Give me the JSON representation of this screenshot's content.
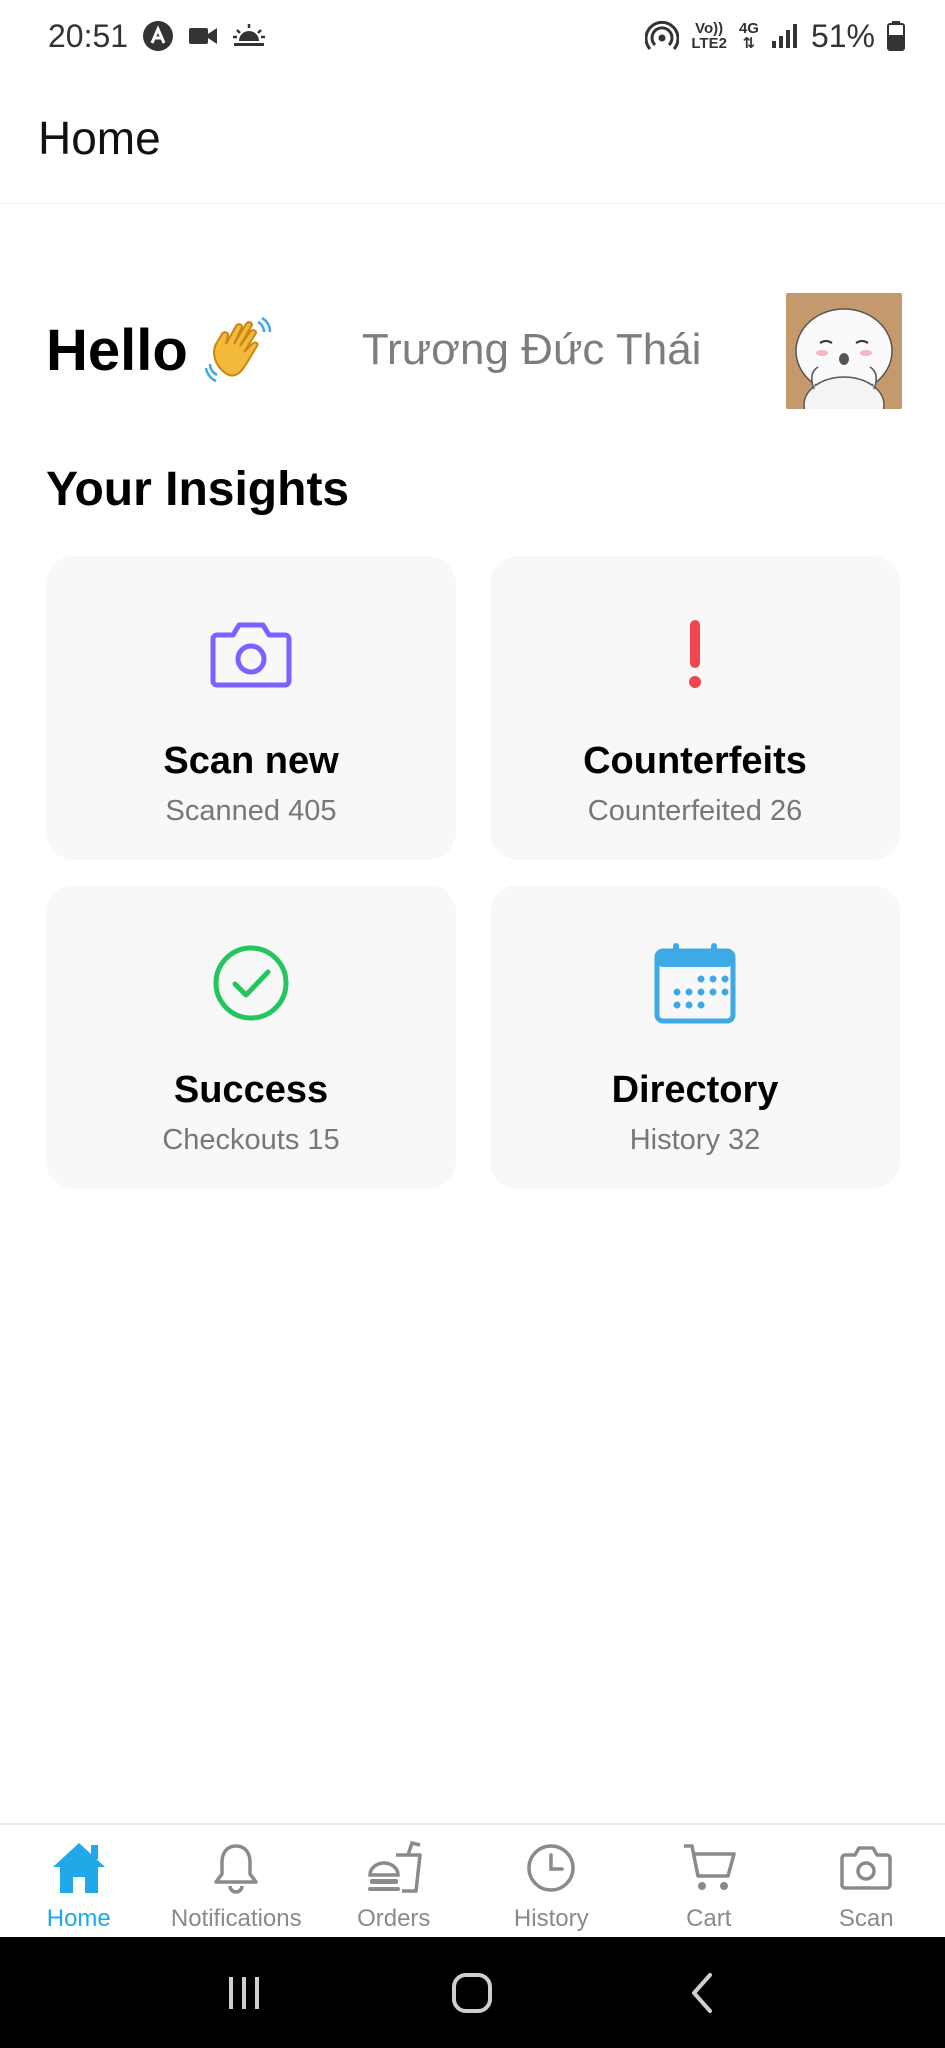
{
  "status_bar": {
    "time": "20:51",
    "volte": "Vo))",
    "lte": "LTE2",
    "network": "4G",
    "battery": "51%"
  },
  "app_bar": {
    "title": "Home"
  },
  "greeting": {
    "hello": "Hello",
    "wave_icon": "waving-hand-emoji",
    "user_name": "Trương Đức Thái"
  },
  "insights": {
    "title": "Your Insights",
    "cards": [
      {
        "title": "Scan new",
        "subtitle": "Scanned 405",
        "icon": "camera-icon",
        "color": "#7b61ff"
      },
      {
        "title": "Counterfeits",
        "subtitle": "Counterfeited 26",
        "icon": "exclamation-icon",
        "color": "#f0444e"
      },
      {
        "title": "Success",
        "subtitle": "Checkouts 15",
        "icon": "check-circle-icon",
        "color": "#22c55e"
      },
      {
        "title": "Directory",
        "subtitle": "History 32",
        "icon": "calendar-icon",
        "color": "#3fa9e6"
      }
    ]
  },
  "tabs": [
    {
      "label": "Home",
      "icon": "home-icon",
      "active": true
    },
    {
      "label": "Notifications",
      "icon": "bell-icon",
      "active": false
    },
    {
      "label": "Orders",
      "icon": "fastfood-icon",
      "active": false
    },
    {
      "label": "History",
      "icon": "clock-icon",
      "active": false
    },
    {
      "label": "Cart",
      "icon": "cart-icon",
      "active": false
    },
    {
      "label": "Scan",
      "icon": "camera-icon",
      "active": false
    }
  ],
  "colors": {
    "active_tab": "#20a8e8",
    "inactive_tab": "#8a8a8a",
    "card_bg": "#f8f8f8"
  }
}
